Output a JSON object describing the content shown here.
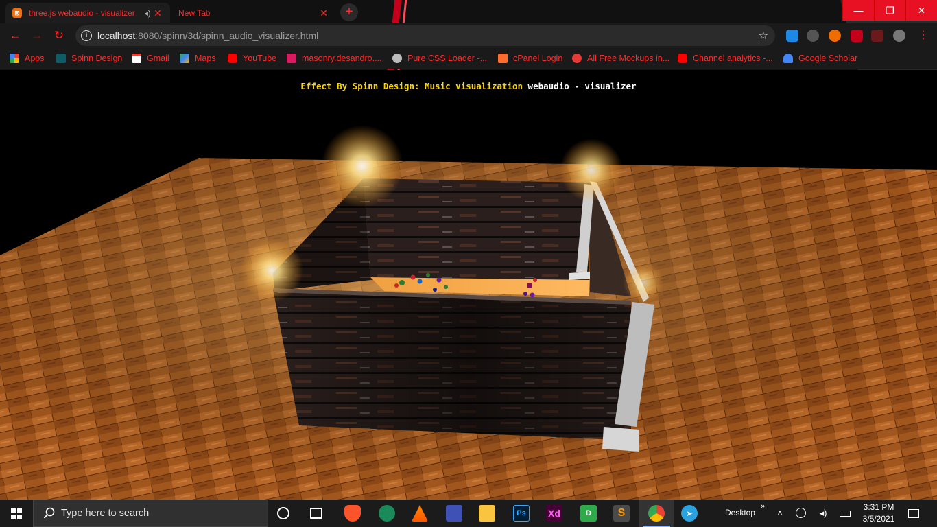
{
  "browser": {
    "tabs": [
      {
        "title": "three.js webaudio - visualizer",
        "active": true
      },
      {
        "title": "New Tab",
        "active": false
      }
    ],
    "newtab_icon": "plus-icon",
    "window_controls": {
      "minimize": "—",
      "restore": "❐",
      "close": "✕"
    },
    "url_host": "localhost",
    "url_path": ":8080/spinn/3d/spinn_audio_visualizer.html",
    "bookmarks": [
      {
        "label": "Apps",
        "icon": "apps-grid-icon"
      },
      {
        "label": "Spinn Design",
        "icon": "spinn-icon"
      },
      {
        "label": "Gmail",
        "icon": "gmail-icon"
      },
      {
        "label": "Maps",
        "icon": "maps-icon"
      },
      {
        "label": "YouTube",
        "icon": "youtube-icon"
      },
      {
        "label": "masonry.desandro....",
        "icon": "masonry-icon"
      },
      {
        "label": "Pure CSS Loader -...",
        "icon": "loader-icon"
      },
      {
        "label": "cPanel Login",
        "icon": "cpanel-icon"
      },
      {
        "label": "All Free Mockups in...",
        "icon": "mockups-icon"
      },
      {
        "label": "Channel analytics -...",
        "icon": "youtube-icon"
      },
      {
        "label": "Google Scholar",
        "icon": "scholar-icon"
      }
    ],
    "accent_color": "#ff2a2a"
  },
  "scene": {
    "caption_yellow": "Effect By Spinn Design: Music visualization",
    "caption_white": "webaudio - visualizer"
  },
  "taskbar": {
    "search_placeholder": "Type here to search",
    "apps": [
      "cortana-icon",
      "task-view-icon",
      "brave-icon",
      "atom-icon",
      "vlc-icon",
      "network-icon",
      "file-explorer-icon",
      "photoshop-icon",
      "adobe-xd-icon",
      "d-app-icon",
      "sublime-icon",
      "chrome-icon",
      "telegram-icon"
    ],
    "photoshop_label": "Ps",
    "xd_label": "Xd",
    "d_label": "D",
    "desktop_label": "Desktop",
    "time": "3:31 PM",
    "date": "3/5/2021"
  }
}
